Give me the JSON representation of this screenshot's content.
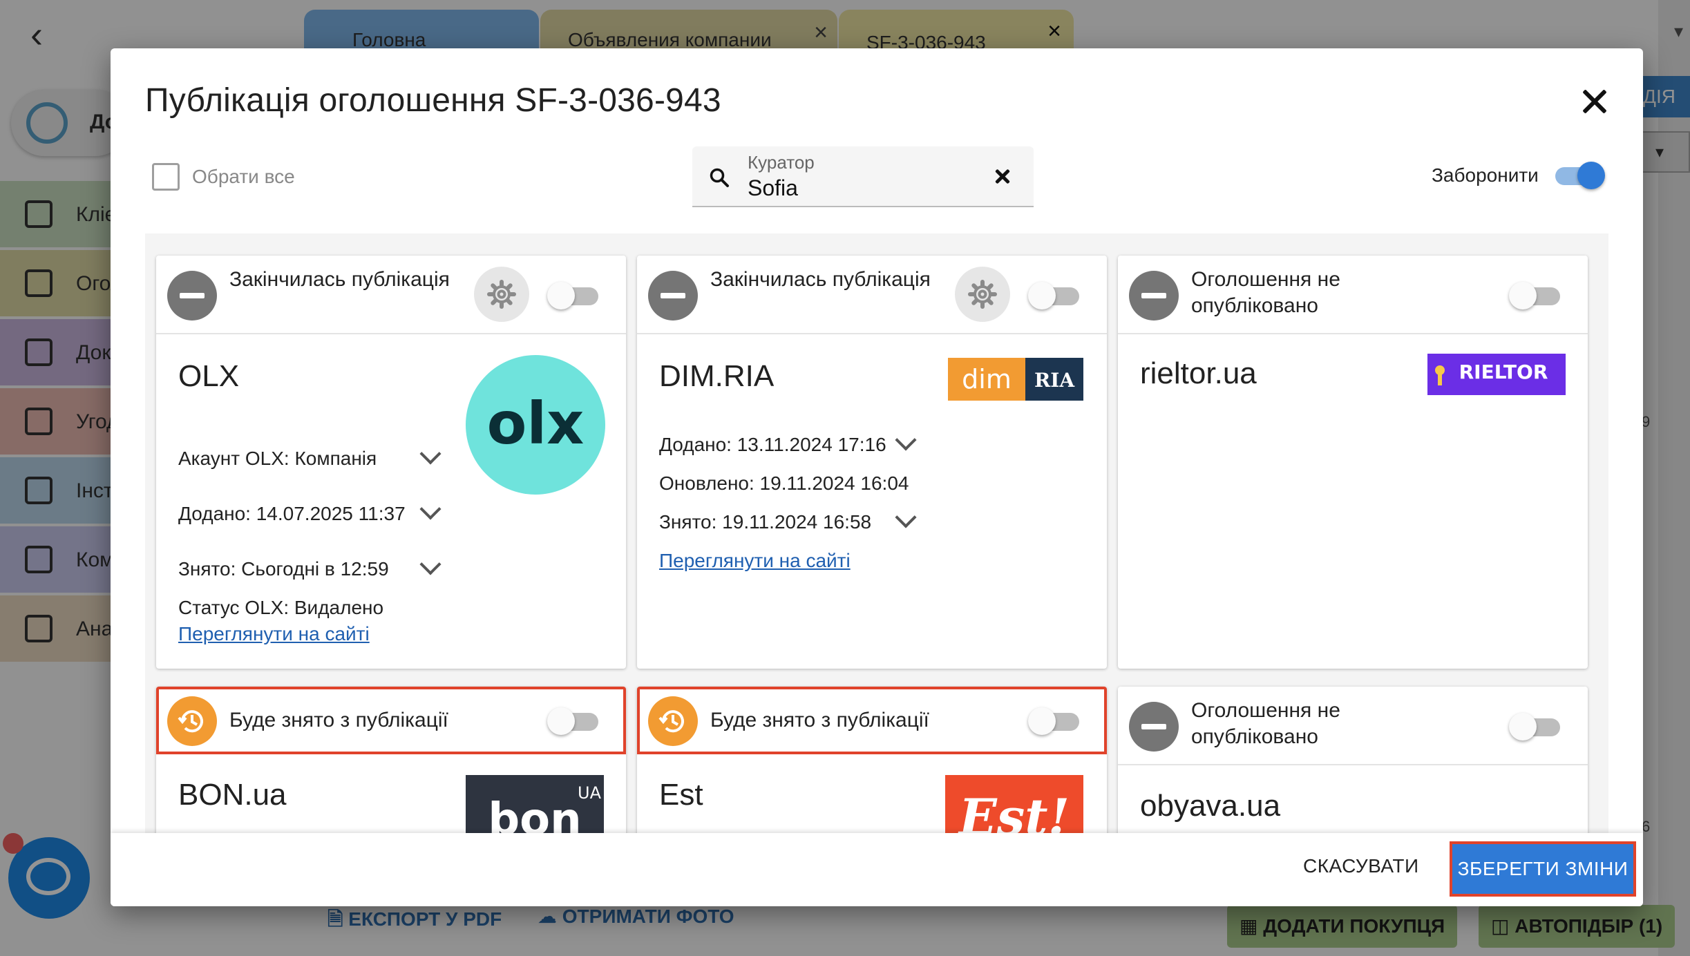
{
  "background": {
    "tabs": [
      {
        "label": "Головна"
      },
      {
        "label": "Объявления компании"
      },
      {
        "label": "SF-3-036-943"
      }
    ],
    "org_label": "До",
    "nav": [
      {
        "label": "Клієнти",
        "color": "#c9dcc0"
      },
      {
        "label": "Оголошення",
        "color": "#dcd7a4"
      },
      {
        "label": "Документи",
        "color": "#c9b6dc"
      },
      {
        "label": "Угоди",
        "color": "#e8b8b0"
      },
      {
        "label": "Інструменти",
        "color": "#b8d4e8"
      },
      {
        "label": "Компанія",
        "color": "#c8c8ec"
      },
      {
        "label": "Аналітика",
        "color": "#e8d8c0"
      }
    ],
    "right_button": "ДІЯ",
    "side_numbers": [
      "9",
      "6"
    ],
    "bottom_left": [
      {
        "label": "ЕКСПОРТ У PDF"
      },
      {
        "label": "ОТРИМАТИ ФОТО"
      }
    ],
    "bottom_right": [
      {
        "label": "ДОДАТИ ПОКУПЦЯ"
      },
      {
        "label": "АВТОПІДБІР (1)"
      }
    ]
  },
  "dialog": {
    "title": "Публікація оголошення SF-3-036-943",
    "select_all_label": "Обрати все",
    "curator": {
      "label": "Куратор",
      "value": "Sofia"
    },
    "forbid_label": "Заборонити",
    "forbid_on": true,
    "cards": [
      {
        "status": "Закінчилась публікація",
        "portal": "OLX",
        "logo": "olx-logo",
        "logo_text": "olx",
        "rows": [
          {
            "text": "Акаунт OLX: Компанія",
            "expandable": true
          },
          {
            "text": "Додано: 14.07.2025 11:37",
            "expandable": true
          },
          {
            "text": "Знято: Сьогодні в 12:59",
            "expandable": true
          },
          {
            "text": "Статус OLX: Видалено",
            "expandable": false
          }
        ],
        "link": "Переглянути на сайті"
      },
      {
        "status": "Закінчилась публікація",
        "portal": "DIM.RIA",
        "logo": "dimria-logo",
        "logo_text_left": "dim",
        "logo_text_right": "RIA",
        "rows": [
          {
            "text": "Додано: 13.11.2024 17:16",
            "expandable": true
          },
          {
            "text": "Оновлено: 19.11.2024 16:04",
            "expandable": false
          },
          {
            "text": "Знято: 19.11.2024 16:58",
            "expandable": true
          }
        ],
        "link": "Переглянути на сайті"
      },
      {
        "status": "Оголошення не опубліковано",
        "portal": "rieltor.ua",
        "logo": "rieltor-logo",
        "logo_text": "RIELTOR"
      },
      {
        "status": "Буде знято з публікації",
        "portal": "BON.ua",
        "logo": "bon-logo",
        "logo_text": "bon",
        "logo_sup": "UA"
      },
      {
        "status": "Буде знято з публікації",
        "portal": "Est",
        "logo": "est-logo",
        "logo_text": "Est!"
      },
      {
        "status": "Оголошення не опубліковано",
        "portal": "obyava.ua"
      }
    ],
    "cancel_label": "СКАСУВАТИ",
    "save_label": "ЗБЕРЕГТИ ЗМІНИ"
  },
  "colors": {
    "accent": "#2f7ad6",
    "highlight": "#e0432b",
    "status_grey": "#757575",
    "status_orange": "#f29b32",
    "olx": "#6fe3dc",
    "dimria": "#f29b32",
    "rieltor": "#6b2ee6",
    "bon": "#2e3440",
    "est": "#ee4b2b"
  }
}
